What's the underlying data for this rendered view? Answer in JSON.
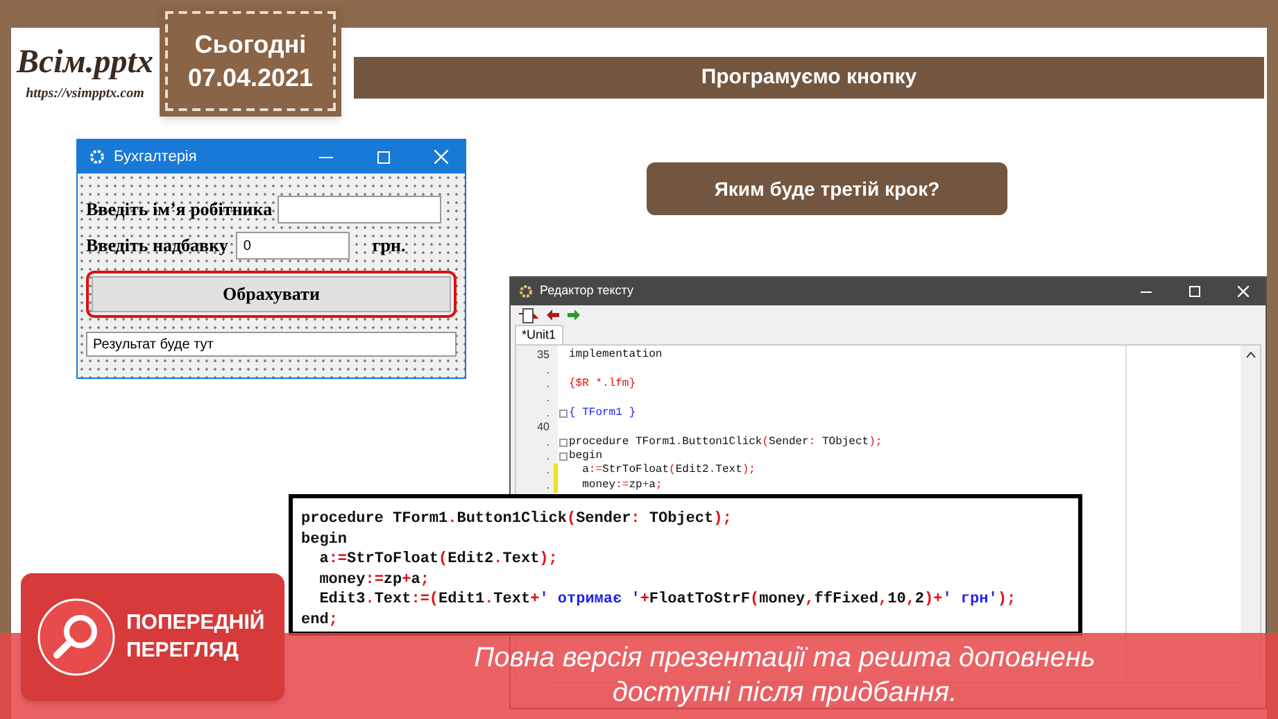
{
  "logo": {
    "title": "Всім.pptx",
    "url": "https://vsimpptx.com"
  },
  "date_tag": {
    "label": "Сьогодні",
    "date": "07.04.2021"
  },
  "slide_title": "Програмуємо кнопку",
  "question_button": "Яким буде третій крок?",
  "form_window": {
    "title": "Бухгалтерія",
    "name_label": "Введіть ім’я робітника",
    "bonus_label": "Введіть надбавку",
    "bonus_value": "0",
    "bonus_unit": "грн.",
    "calc_button": {
      "label": "Обрахувати",
      "highlighted": true
    },
    "result": "Результат буде тут"
  },
  "editor_window": {
    "title": "Редактор тексту",
    "tab": "*Unit1",
    "lines": [
      {
        "number": "35",
        "fold": false,
        "changed": false,
        "segments": [
          {
            "kind": "ident",
            "text": "implementation"
          }
        ]
      },
      {
        "number": ".",
        "fold": false,
        "changed": false
      },
      {
        "number": ".",
        "fold": false,
        "changed": false,
        "segments": [
          {
            "kind": "directive",
            "text": "{$R *.lfm}"
          }
        ]
      },
      {
        "number": ".",
        "fold": false,
        "changed": false
      },
      {
        "number": ".",
        "fold": true,
        "changed": false,
        "segments": [
          {
            "kind": "comment",
            "text": "{ TForm1 }"
          }
        ]
      },
      {
        "number": "40",
        "fold": false,
        "changed": false
      },
      {
        "number": ".",
        "fold": true,
        "changed": false,
        "segments": [
          {
            "kind": "ident",
            "text": "procedure TForm1"
          },
          {
            "kind": "symbol",
            "text": "."
          },
          {
            "kind": "ident",
            "text": "Button1Click"
          },
          {
            "kind": "symbol",
            "text": "("
          },
          {
            "kind": "ident",
            "text": "Sender"
          },
          {
            "kind": "symbol",
            "text": ":"
          },
          {
            "kind": "ident",
            "text": " TObject"
          },
          {
            "kind": "symbol",
            "text": ");"
          }
        ]
      },
      {
        "number": ".",
        "fold": true,
        "changed": false,
        "segments": [
          {
            "kind": "ident",
            "text": "begin"
          }
        ]
      },
      {
        "number": ".",
        "fold": false,
        "changed": true,
        "segments": [
          {
            "kind": "ident",
            "text": "  a"
          },
          {
            "kind": "symbol",
            "text": ":="
          },
          {
            "kind": "ident",
            "text": "StrToFloat"
          },
          {
            "kind": "symbol",
            "text": "("
          },
          {
            "kind": "ident",
            "text": "Edit2"
          },
          {
            "kind": "symbol",
            "text": "."
          },
          {
            "kind": "ident",
            "text": "Text"
          },
          {
            "kind": "symbol",
            "text": ");"
          }
        ]
      },
      {
        "number": ".",
        "fold": false,
        "changed": true,
        "segments": [
          {
            "kind": "ident",
            "text": "  money"
          },
          {
            "kind": "symbol",
            "text": ":="
          },
          {
            "kind": "ident",
            "text": "zp"
          },
          {
            "kind": "symbol",
            "text": "+"
          },
          {
            "kind": "ident",
            "text": "a"
          },
          {
            "kind": "symbol",
            "text": ";"
          }
        ]
      }
    ]
  },
  "code_popup": {
    "lines": [
      [
        {
          "kind": "ident",
          "text": "procedure TForm1"
        },
        {
          "kind": "symbol",
          "text": "."
        },
        {
          "kind": "ident",
          "text": "Button1Click"
        },
        {
          "kind": "symbol",
          "text": "("
        },
        {
          "kind": "ident",
          "text": "Sender"
        },
        {
          "kind": "symbol",
          "text": ":"
        },
        {
          "kind": "ident",
          "text": " TObject"
        },
        {
          "kind": "symbol",
          "text": ");"
        }
      ],
      [
        {
          "kind": "ident",
          "text": "begin"
        }
      ],
      [
        {
          "kind": "ident",
          "text": "  a"
        },
        {
          "kind": "symbol",
          "text": ":="
        },
        {
          "kind": "ident",
          "text": "StrToFloat"
        },
        {
          "kind": "symbol",
          "text": "("
        },
        {
          "kind": "ident",
          "text": "Edit2"
        },
        {
          "kind": "symbol",
          "text": "."
        },
        {
          "kind": "ident",
          "text": "Text"
        },
        {
          "kind": "symbol",
          "text": ");"
        }
      ],
      [
        {
          "kind": "ident",
          "text": "  money"
        },
        {
          "kind": "symbol",
          "text": ":="
        },
        {
          "kind": "ident",
          "text": "zp"
        },
        {
          "kind": "symbol",
          "text": "+"
        },
        {
          "kind": "ident",
          "text": "a"
        },
        {
          "kind": "symbol",
          "text": ";"
        }
      ],
      [
        {
          "kind": "ident",
          "text": "  Edit3"
        },
        {
          "kind": "symbol",
          "text": "."
        },
        {
          "kind": "ident",
          "text": "Text"
        },
        {
          "kind": "symbol",
          "text": ":=("
        },
        {
          "kind": "ident",
          "text": "Edit1"
        },
        {
          "kind": "symbol",
          "text": "."
        },
        {
          "kind": "ident",
          "text": "Text"
        },
        {
          "kind": "symbol",
          "text": "+"
        },
        {
          "kind": "string",
          "text": "' отримає '"
        },
        {
          "kind": "symbol",
          "text": "+"
        },
        {
          "kind": "ident",
          "text": "FloatToStrF"
        },
        {
          "kind": "symbol",
          "text": "("
        },
        {
          "kind": "ident",
          "text": "money"
        },
        {
          "kind": "symbol",
          "text": ","
        },
        {
          "kind": "ident",
          "text": "ffFixed"
        },
        {
          "kind": "symbol",
          "text": ","
        },
        {
          "kind": "ident",
          "text": "10"
        },
        {
          "kind": "symbol",
          "text": ","
        },
        {
          "kind": "ident",
          "text": "2"
        },
        {
          "kind": "symbol",
          "text": ")+"
        },
        {
          "kind": "string",
          "text": "' грн'"
        },
        {
          "kind": "symbol",
          "text": ");"
        }
      ],
      [
        {
          "kind": "ident",
          "text": "end"
        },
        {
          "kind": "symbol",
          "text": ";"
        }
      ]
    ]
  },
  "preview_banner": {
    "badge": "ПОПЕРЕДНІЙ ПЕРЕГЛЯД",
    "message_lines": [
      "Повна версія презентації та решта доповнень",
      "доступні після придбання."
    ]
  }
}
